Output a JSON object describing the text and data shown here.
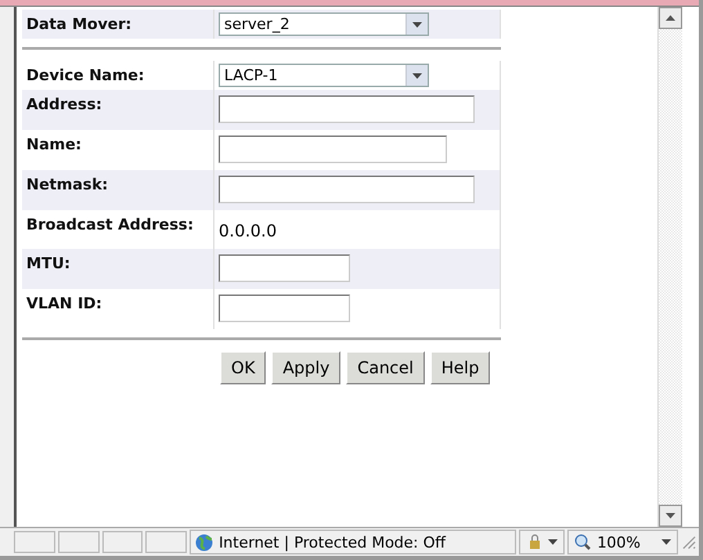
{
  "form": {
    "data_mover": {
      "label": "Data Mover:",
      "value": "server_2"
    },
    "fields": [
      {
        "label": "Device Name:",
        "kind": "select",
        "value": "LACP-1"
      },
      {
        "label": "Address:",
        "kind": "long-input"
      },
      {
        "label": "Name:",
        "kind": "medium-input"
      },
      {
        "label": "Netmask:",
        "kind": "long-input"
      },
      {
        "label": "Broadcast Address:",
        "kind": "text",
        "value": "0.0.0.0"
      },
      {
        "label": "MTU:",
        "kind": "short-input"
      },
      {
        "label": "VLAN ID:",
        "kind": "short-input"
      }
    ],
    "buttons": [
      "OK",
      "Apply",
      "Cancel",
      "Help"
    ]
  },
  "status_bar": {
    "zone": "Internet | Protected Mode: Off",
    "zoom": "100%"
  }
}
